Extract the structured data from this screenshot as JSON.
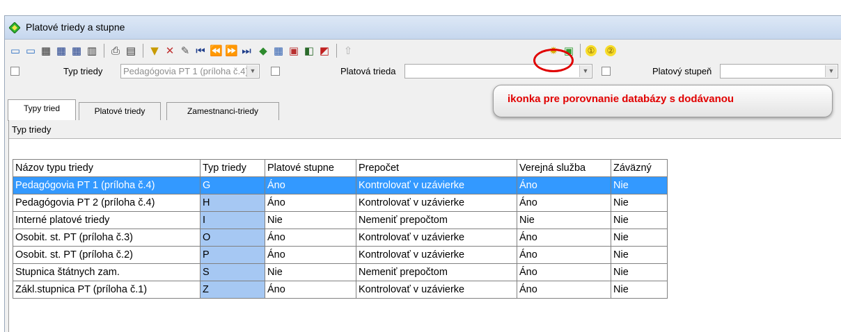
{
  "window": {
    "title": "Platové triedy a stupne",
    "icon": "green-diamond-icon"
  },
  "toolbar": {
    "buttons": [
      "insert-record-icon",
      "delete-record-icon",
      "grid-view-icon",
      "table-edit-icon",
      "table-copy-icon",
      "trash-icon",
      "print-icon",
      "preview-icon",
      "filter-icon",
      "clear-filter-icon",
      "edit-pen-icon",
      "first-record-icon",
      "previous-record-icon",
      "next-record-icon",
      "last-record-icon",
      "multi-color-icon",
      "calendar-icon",
      "export-icon",
      "import-icon",
      "red-green-icon",
      "up-arrow-icon",
      "compare-database-icon",
      "green-database-icon"
    ],
    "num1": "①",
    "num2": "②"
  },
  "filters": {
    "typ_triedy_label": "Typ triedy",
    "typ_triedy_value": "Pedagógovia PT 1 (príloha č.4)",
    "platova_trieda_label": "Platová trieda",
    "platovy_stupen_label": "Platový stupeň"
  },
  "tabs": [
    "Typy tried",
    "Platové triedy",
    "Zamestnanci-triedy"
  ],
  "panel": {
    "title": "Typ triedy"
  },
  "table": {
    "headers": [
      "Názov typu triedy",
      "Typ triedy",
      "Platové stupne",
      "Prepočet",
      "Verejná služba",
      "Záväzný"
    ],
    "rows": [
      [
        "Pedagógovia PT 1 (príloha č.4)",
        "G",
        "Áno",
        "Kontrolovať v uzávierke",
        "Áno",
        "Nie"
      ],
      [
        "Pedagógovia PT 2 (príloha č.4)",
        "H",
        "Áno",
        "Kontrolovať v uzávierke",
        "Áno",
        "Nie"
      ],
      [
        "Interné platové triedy",
        "I",
        "Nie",
        "Nemeniť prepočtom",
        "Nie",
        "Nie"
      ],
      [
        "Osobit. st. PT (príloha č.3)",
        "O",
        "Áno",
        "Kontrolovať v uzávierke",
        "Áno",
        "Nie"
      ],
      [
        "Osobit. st. PT (príloha č.2)",
        "P",
        "Áno",
        "Kontrolovať v uzávierke",
        "Áno",
        "Nie"
      ],
      [
        "Stupnica štátnych zam.",
        "S",
        "Nie",
        "Nemeniť prepočtom",
        "Áno",
        "Nie"
      ],
      [
        "Zákl.stupnica PT (príloha č.1)",
        "Z",
        "Áno",
        "Kontrolovať v uzávierke",
        "Áno",
        "Nie"
      ]
    ]
  },
  "annotation": {
    "text": "ikonka pre porovnanie databázy s dodávanou"
  },
  "colors": {
    "selected_row": "#3399ff",
    "code_column": "#a6c8f3",
    "annotation_red": "#e10000"
  }
}
